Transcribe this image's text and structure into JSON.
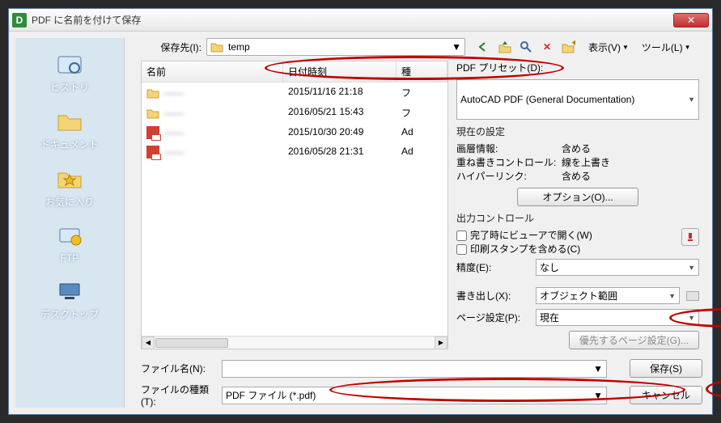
{
  "title": "PDF に名前を付けて保存",
  "saveTo": {
    "label": "保存先(I):",
    "value": "temp"
  },
  "toolbar": {
    "display": "表示(V)",
    "tools": "ツール(L)"
  },
  "sidebar": {
    "items": [
      {
        "label": "ヒストリ"
      },
      {
        "label": "ドキュメント"
      },
      {
        "label": "お気に入り"
      },
      {
        "label": "FTP"
      },
      {
        "label": "デスクトップ"
      }
    ]
  },
  "filelist": {
    "headers": {
      "name": "名前",
      "date": "日付時刻",
      "type": "種"
    },
    "rows": [
      {
        "name": "——",
        "date": "2015/11/16 21:18",
        "type": "フ",
        "icon": "folder"
      },
      {
        "name": "——",
        "date": "2016/05/21 15:43",
        "type": "フ",
        "icon": "folder"
      },
      {
        "name": "——",
        "date": "2015/10/30 20:49",
        "type": "Ad",
        "icon": "pdf"
      },
      {
        "name": "——",
        "date": "2016/05/28 21:31",
        "type": "Ad",
        "icon": "pdf"
      }
    ]
  },
  "right": {
    "presetLabel": "PDF プリセット(D):",
    "presetValue": "AutoCAD PDF (General Documentation)",
    "currentSettings": {
      "title": "現在の設定",
      "layerInfo": {
        "k": "画層情報:",
        "v": "含める"
      },
      "mergeControl": {
        "k": "重ね書きコントロール:",
        "v": "線を上書き"
      },
      "hyperlink": {
        "k": "ハイパーリンク:",
        "v": "含める"
      },
      "optionsBtn": "オプション(O)..."
    },
    "outputControl": {
      "title": "出力コントロール",
      "openViewer": "完了時にビューアで開く(W)",
      "printStamp": "印刷スタンプを含める(C)",
      "precisionLabel": "精度(E):",
      "precisionValue": "なし"
    },
    "export": {
      "label": "書き出し(X):",
      "value": "オブジェクト範囲"
    },
    "pageSetup": {
      "label": "ページ設定(P):",
      "value": "現在"
    },
    "overridePageSetup": "優先するページ設定(G)..."
  },
  "bottom": {
    "fileNameLabel": "ファイル名(N):",
    "fileNameValue": "",
    "fileTypeLabel": "ファイルの種類(T):",
    "fileTypeValue": "PDF ファイル (*.pdf)",
    "save": "保存(S)",
    "cancel": "キャンセル"
  }
}
